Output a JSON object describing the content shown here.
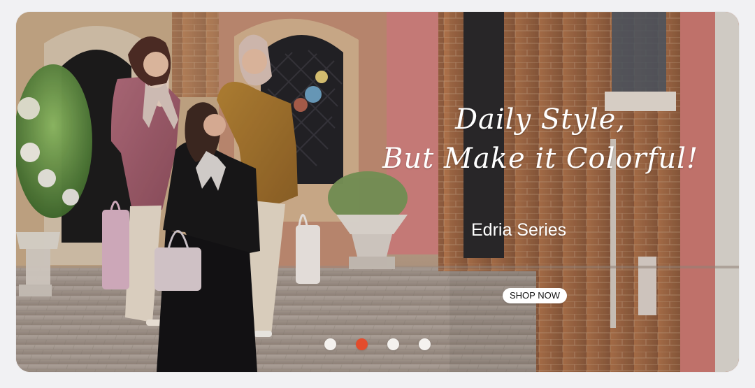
{
  "banner": {
    "headline_line_1": "Daily Style,",
    "headline_line_2": "But Make it Colorful!",
    "series_name": "Edria Series",
    "cta_label": "SHOP NOW"
  },
  "carousel": {
    "active_slide": 2,
    "slide_count": 4
  },
  "colors": {
    "background": "#f1f1f3",
    "cta_background": "#ffffff",
    "active_dot": "#e34c2c",
    "inactive_dot": "#f4f1ee"
  },
  "icons": {
    "dot_shape": "circle"
  }
}
